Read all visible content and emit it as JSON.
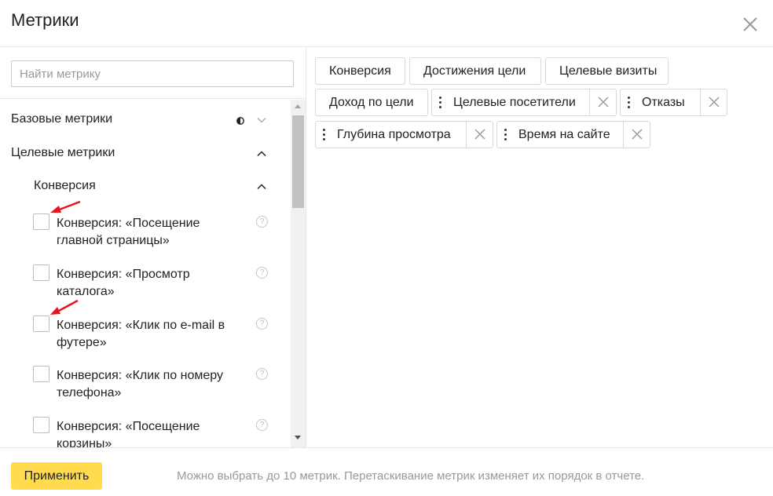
{
  "dialog": {
    "title": "Метрики"
  },
  "search": {
    "placeholder": "Найти метрику",
    "value": ""
  },
  "groups": {
    "basic": {
      "label": "Базовые метрики"
    },
    "goal": {
      "label": "Целевые метрики"
    },
    "conversion": {
      "label": "Конверсия"
    }
  },
  "items": [
    {
      "label": "Конверсия: «Посещение главной страницы»",
      "help": "?"
    },
    {
      "label": "Конверсия: «Просмотр каталога»",
      "help": "?"
    },
    {
      "label": "Конверсия: «Клик по e-mail в футере»",
      "help": "?"
    },
    {
      "label": "Конверсия: «Клик по номеру телефона»",
      "help": "?"
    },
    {
      "label": "Конверсия: «Посещение корзины»",
      "help": "?"
    }
  ],
  "selected_metrics": [
    {
      "label": "Конверсия"
    },
    {
      "label": "Достижения цели"
    },
    {
      "label": "Целевые визиты"
    },
    {
      "label": "Доход по цели"
    },
    {
      "label": "Целевые посетители"
    },
    {
      "label": "Отказы"
    },
    {
      "label": "Глубина просмотра"
    },
    {
      "label": "Время на сайте"
    }
  ],
  "footer": {
    "apply_label": "Применить",
    "hint": "Можно выбрать до 10 метрик. Перетаскивание метрик изменяет их порядок в отчете."
  },
  "colors": {
    "accent": "#ffdb4d",
    "annotation_arrow": "#e8141b"
  }
}
